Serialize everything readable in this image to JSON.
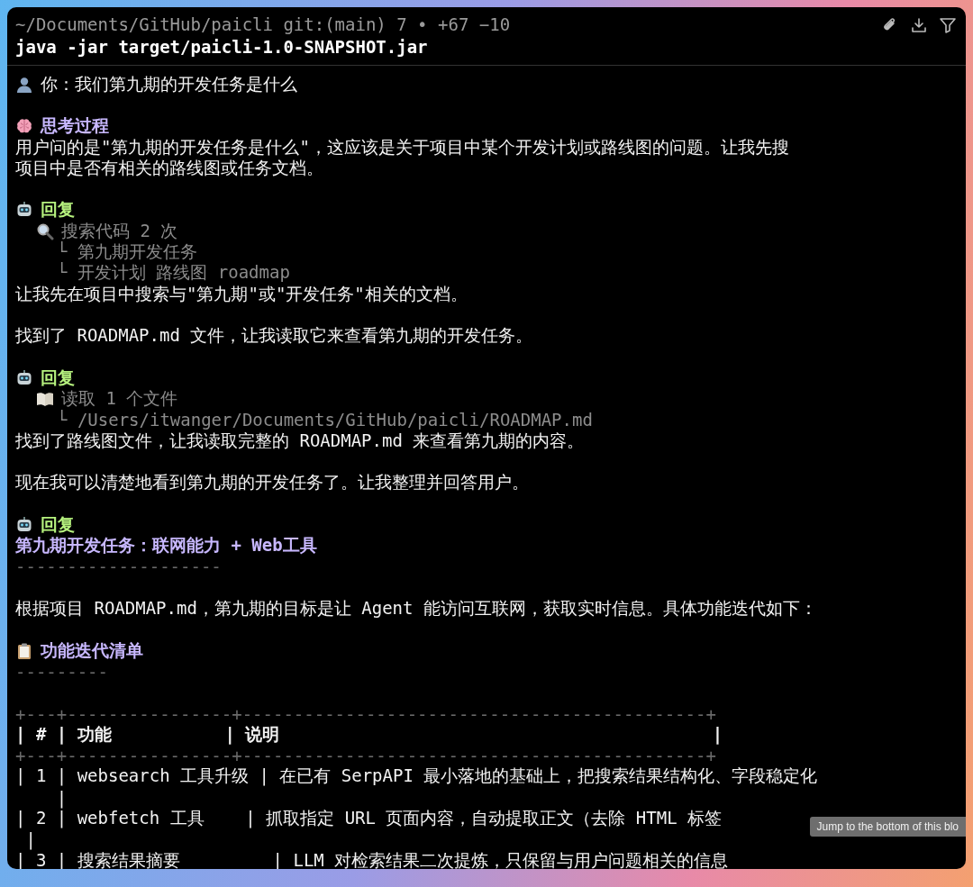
{
  "header": {
    "path": "~/Documents/GitHub/paicli git:(main) 7 • +67 −10",
    "command": "java -jar target/paicli-1.0-SNAPSHOT.jar"
  },
  "lines": [
    {
      "kind": "user",
      "text": "你：我们第九期的开发任务是什么"
    },
    {
      "kind": "blank"
    },
    {
      "kind": "thinking",
      "text": "思考过程"
    },
    {
      "kind": "body",
      "text": "用户问的是\"第九期的开发任务是什么\"，这应该是关于项目中某个开发计划或路线图的问题。让我先搜"
    },
    {
      "kind": "body",
      "text": "项目中是否有相关的路线图或任务文档。"
    },
    {
      "kind": "blank"
    },
    {
      "kind": "reply",
      "text": "回复"
    },
    {
      "kind": "search",
      "text": "搜索代码 2 次"
    },
    {
      "kind": "arg",
      "text": "└ 第九期开发任务"
    },
    {
      "kind": "arg",
      "text": "└ 开发计划 路线图 roadmap"
    },
    {
      "kind": "body",
      "text": "让我先在项目中搜索与\"第九期\"或\"开发任务\"相关的文档。"
    },
    {
      "kind": "blank"
    },
    {
      "kind": "body",
      "text": "找到了 ROADMAP.md 文件，让我读取它来查看第九期的开发任务。"
    },
    {
      "kind": "blank"
    },
    {
      "kind": "reply",
      "text": "回复"
    },
    {
      "kind": "read",
      "text": "读取 1 个文件"
    },
    {
      "kind": "arg",
      "text": "└ /Users/itwanger/Documents/GitHub/paicli/ROADMAP.md"
    },
    {
      "kind": "body",
      "text": "找到了路线图文件，让我读取完整的 ROADMAP.md 来查看第九期的内容。"
    },
    {
      "kind": "blank"
    },
    {
      "kind": "body",
      "text": "现在我可以清楚地看到第九期的开发任务了。让我整理并回答用户。"
    },
    {
      "kind": "blank"
    },
    {
      "kind": "reply",
      "text": "回复"
    },
    {
      "kind": "title",
      "text": "第九期开发任务：联网能力 + Web工具"
    },
    {
      "kind": "rule",
      "text": "--------------------"
    },
    {
      "kind": "blank"
    },
    {
      "kind": "body",
      "text": "根据项目 ROADMAP.md，第九期的目标是让 Agent 能访问互联网，获取实时信息。具体功能迭代如下："
    },
    {
      "kind": "blank"
    },
    {
      "kind": "section",
      "text": "功能迭代清单"
    },
    {
      "kind": "rule",
      "text": "---------"
    },
    {
      "kind": "blank"
    },
    {
      "kind": "table-border",
      "text": "+---+----------------+---------------------------------------------+"
    },
    {
      "kind": "table-head",
      "text": "| # | 功能           | 说明                                          |"
    },
    {
      "kind": "table-border",
      "text": "+---+----------------+---------------------------------------------+"
    },
    {
      "kind": "table-row",
      "text": "| 1 | websearch 工具升级 | 在已有 SerpAPI 最小落地的基础上，把搜索结果结构化、字段稳定化"
    },
    {
      "kind": "table-row",
      "text": "    |"
    },
    {
      "kind": "table-row",
      "text": "| 2 | webfetch 工具    | 抓取指定 URL 页面内容，自动提取正文（去除 HTML 标签"
    },
    {
      "kind": "table-row",
      "text": " |"
    },
    {
      "kind": "table-row",
      "text": "| 3 | 搜索结果摘要         | LLM 对检索结果二次提炼，只保留与用户问题相关的信息"
    }
  ],
  "tooltip": "Jump to the bottom of this blo"
}
